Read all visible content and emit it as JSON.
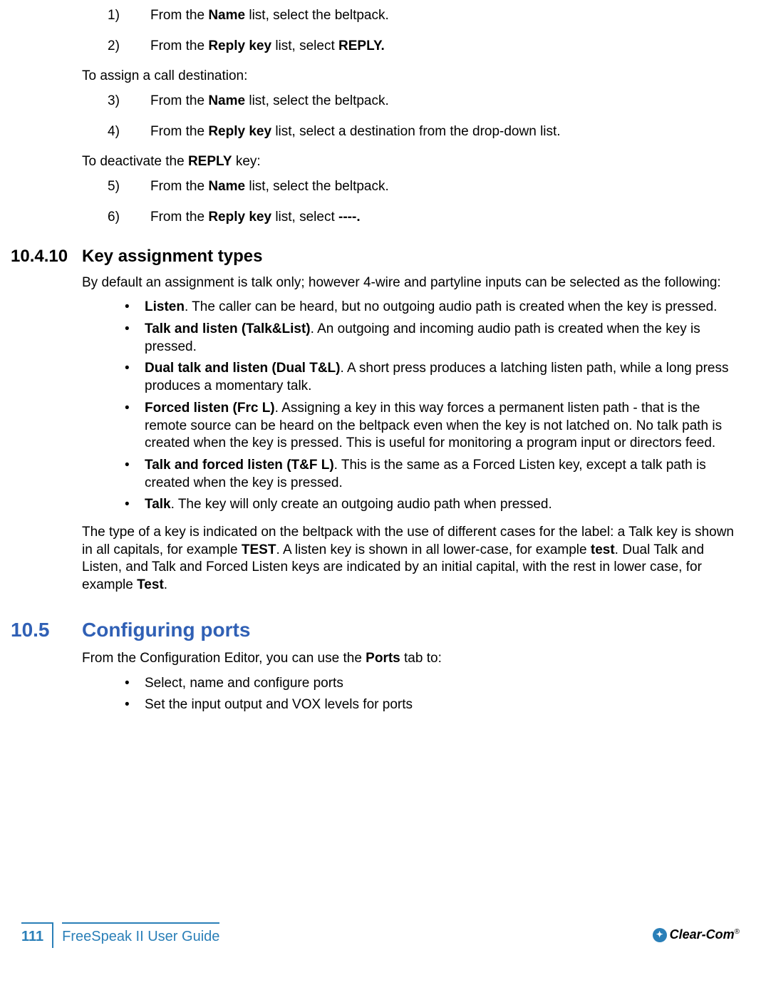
{
  "steps": {
    "s1_num": "1)",
    "s1_pre": "From the ",
    "s1_b1": "Name",
    "s1_post": " list, select the beltpack.",
    "s2_num": "2)",
    "s2_pre": "From the ",
    "s2_b1": "Reply key",
    "s2_mid": " list, select ",
    "s2_b2": "REPLY.",
    "s3_num": "3)",
    "s3_pre": "From the ",
    "s3_b1": "Name",
    "s3_post": " list, select the beltpack.",
    "s4_num": "4)",
    "s4_pre": "From the ",
    "s4_b1": "Reply key",
    "s4_post": " list, select a destination from the drop-down list.",
    "s5_num": "5)",
    "s5_pre": "From the ",
    "s5_b1": "Name",
    "s5_post": " list, select the beltpack.",
    "s6_num": "6)",
    "s6_pre": "From the ",
    "s6_b1": "Reply key",
    "s6_mid": " list, select ",
    "s6_b2": "----."
  },
  "text": {
    "assign_call": "To assign a call destination:",
    "deactivate_pre": "To deactivate the ",
    "deactivate_b": "REPLY",
    "deactivate_post": " key:"
  },
  "sec10410": {
    "num": "10.4.10",
    "title": "Key assignment types",
    "intro": "By default an assignment is talk only; however 4-wire and partyline inputs can be selected as the following:",
    "b1_t": "Listen",
    "b1_d": ". The caller can be heard, but no outgoing audio path is created when the key is pressed.",
    "b2_t": "Talk and listen (Talk&List)",
    "b2_d": ". An outgoing and incoming audio path is created when the key is pressed.",
    "b3_t": "Dual talk and listen (Dual T&L)",
    "b3_d": ". A short press produces a latching listen path, while a long press produces a momentary talk.",
    "b4_t": "Forced listen (Frc L)",
    "b4_d": ". Assigning a key in this way forces a permanent listen path - that is the remote source can be heard on the beltpack even when the key is not latched on. No talk path is created when the key is pressed. This is useful for monitoring a program input or directors feed.",
    "b5_t": "Talk and forced listen (T&F L)",
    "b5_d": ". This is the same as a Forced Listen key, except a talk path is created when the key is pressed.",
    "b6_t": "Talk",
    "b6_d": ". The key will only create an outgoing audio path when pressed.",
    "para_1": "The type of a key is indicated on the beltpack with the use of different cases for the label: a Talk key is shown in all capitals, for example ",
    "para_b1": "TEST",
    "para_2": ". A listen key is shown in all lower-case, for example ",
    "para_b2": "test",
    "para_3": ". Dual Talk and Listen, and Talk and Forced Listen keys are indicated by an initial capital, with the rest in lower case, for example ",
    "para_b3": "Test",
    "para_4": "."
  },
  "sec105": {
    "num": "10.5",
    "title": "Configuring ports",
    "intro_pre": "From the Configuration Editor, you can use the ",
    "intro_b": "Ports",
    "intro_post": " tab to:",
    "b1": "Select, name and configure ports",
    "b2": "Set the input output and VOX levels for ports"
  },
  "footer": {
    "page": "111",
    "guide": "FreeSpeak II User Guide",
    "logo": "Clear-Com",
    "reg": "®"
  }
}
